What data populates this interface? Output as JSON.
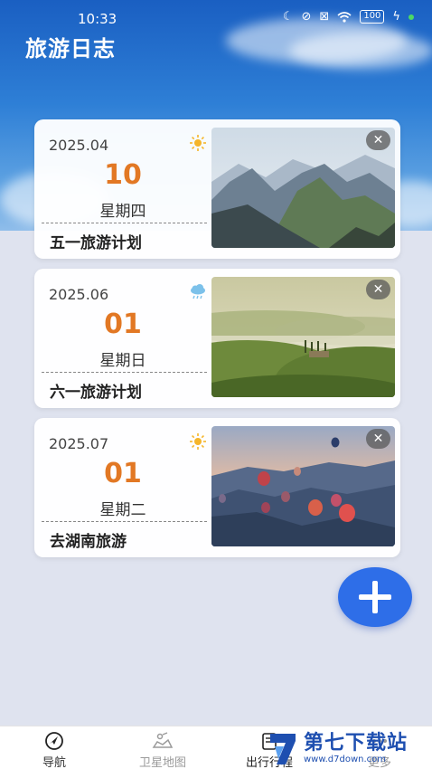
{
  "status_bar": {
    "time": "10:33",
    "battery": "100"
  },
  "header": {
    "title": "旅游日志"
  },
  "cards": [
    {
      "date": "2025.04",
      "day": "10",
      "weekday": "星期四",
      "plan": "五一旅游计划",
      "weather": "sun-icon",
      "photo": "mountain-landscape"
    },
    {
      "date": "2025.06",
      "day": "01",
      "weekday": "星期日",
      "plan": "六一旅游计划",
      "weather": "rain-cloud-icon",
      "photo": "misty-green-hills"
    },
    {
      "date": "2025.07",
      "day": "01",
      "weekday": "星期二",
      "plan": "去湖南旅游",
      "weather": "sun-icon",
      "photo": "hot-air-balloons"
    }
  ],
  "fab": {
    "icon": "plus-icon"
  },
  "bottom_nav": [
    {
      "label": "导航",
      "icon": "compass-icon"
    },
    {
      "label": "卫星地图",
      "icon": "satellite-map-icon"
    },
    {
      "label": "出行行程",
      "icon": "itinerary-icon"
    },
    {
      "label": "更多",
      "icon": "more-icon"
    }
  ],
  "watermark": {
    "name": "第七下载站",
    "url": "www.d7down.com"
  },
  "colors": {
    "accent": "#2e6ee8",
    "day_number": "#e27824",
    "sky": "#2e7fd6",
    "background": "#dfe3ef"
  }
}
